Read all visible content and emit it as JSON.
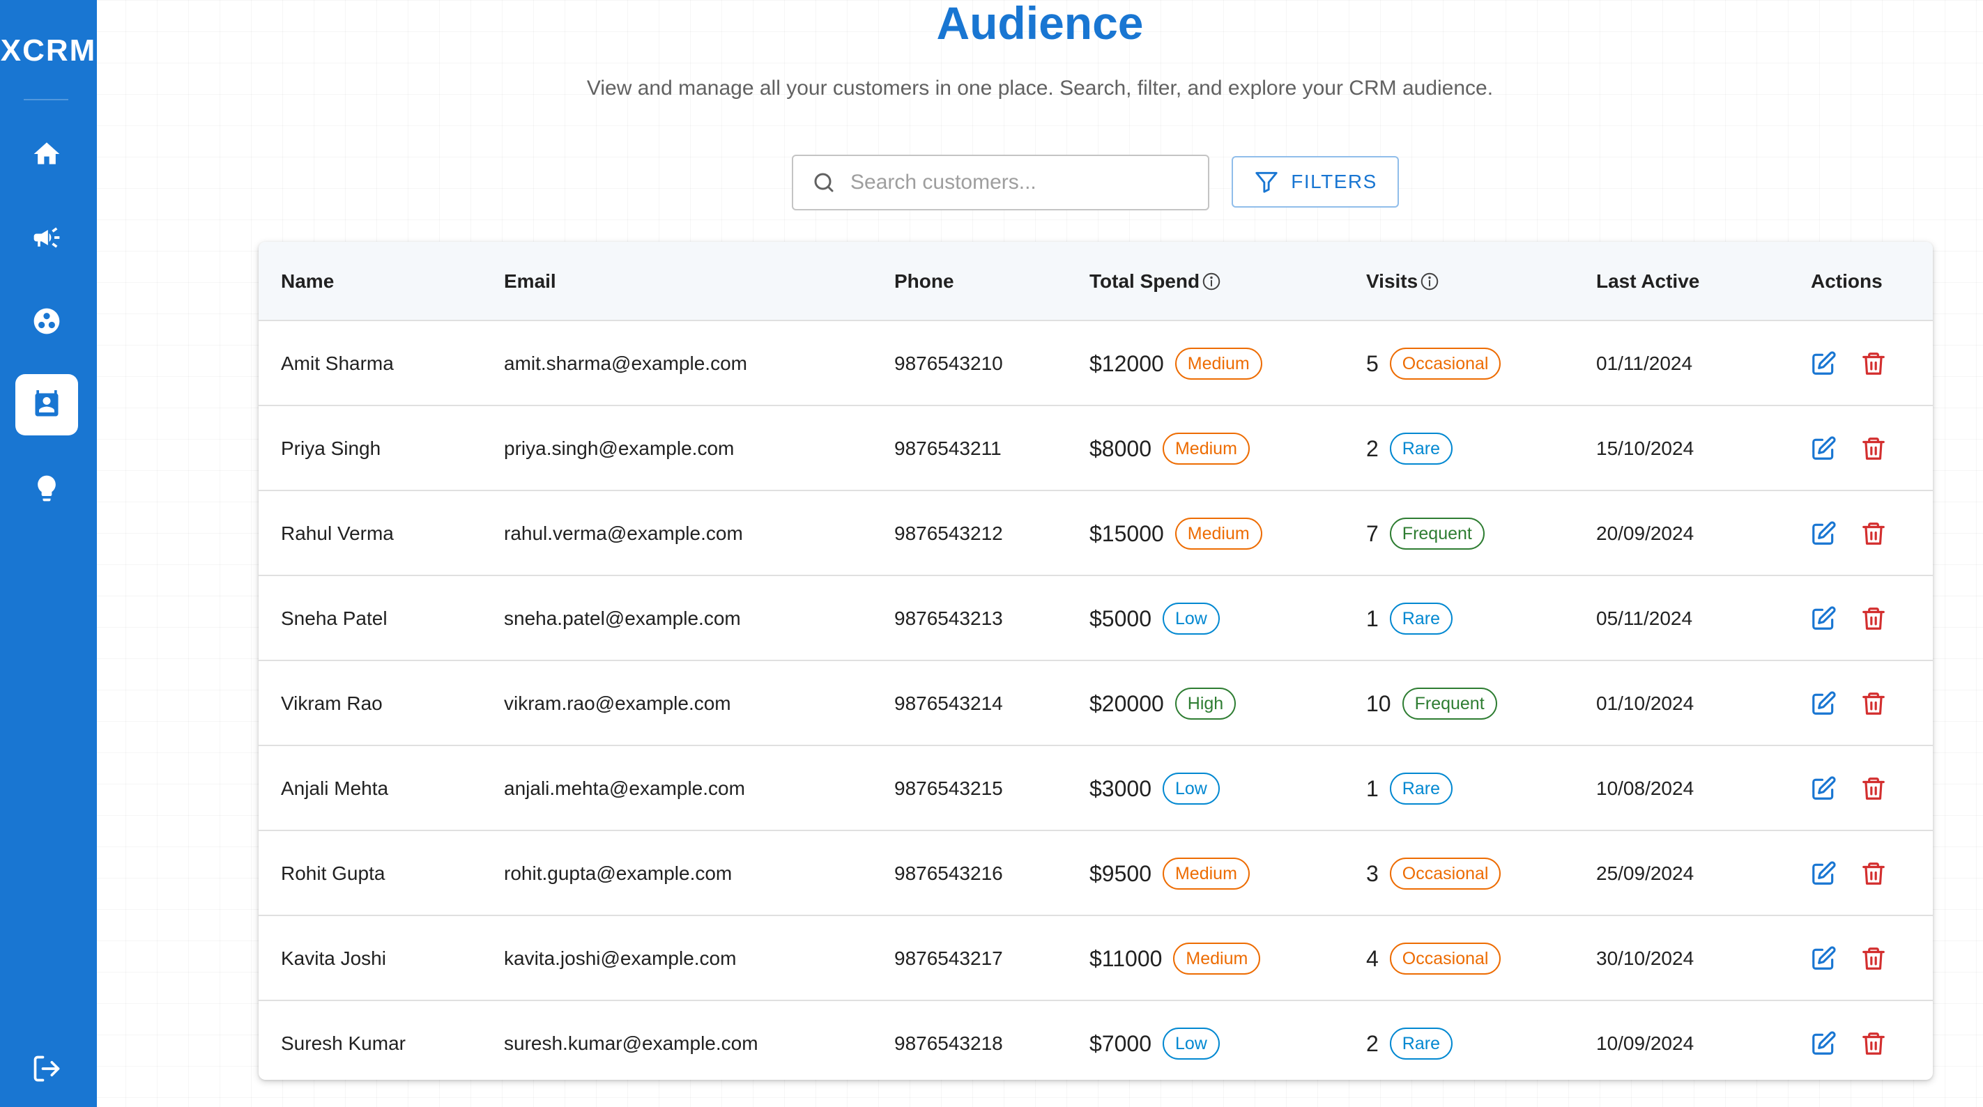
{
  "app": {
    "brand": "XCRM"
  },
  "sidebar": {
    "items": [
      {
        "name": "home",
        "icon": "home-icon",
        "active": false
      },
      {
        "name": "campaigns",
        "icon": "megaphone-icon",
        "active": false
      },
      {
        "name": "segments",
        "icon": "segments-icon",
        "active": false
      },
      {
        "name": "audience",
        "icon": "contact-card-icon",
        "active": true
      },
      {
        "name": "insights",
        "icon": "lightbulb-icon",
        "active": false
      }
    ],
    "logout_icon": "logout-icon"
  },
  "header": {
    "title": "Audience",
    "subtitle": "View and manage all your customers in one place. Search, filter, and explore your CRM audience."
  },
  "search": {
    "placeholder": "Search customers...",
    "value": ""
  },
  "filters": {
    "label": "FILTERS"
  },
  "table": {
    "columns": {
      "name": "Name",
      "email": "Email",
      "phone": "Phone",
      "spend": "Total Spend",
      "visits": "Visits",
      "last_active": "Last Active",
      "actions": "Actions"
    },
    "rows": [
      {
        "name": "Amit Sharma",
        "email": "amit.sharma@example.com",
        "phone": "9876543210",
        "spend": "$12000",
        "spend_tier": "Medium",
        "visits": "5",
        "visit_tier": "Occasional",
        "last_active": "01/11/2024"
      },
      {
        "name": "Priya Singh",
        "email": "priya.singh@example.com",
        "phone": "9876543211",
        "spend": "$8000",
        "spend_tier": "Medium",
        "visits": "2",
        "visit_tier": "Rare",
        "last_active": "15/10/2024"
      },
      {
        "name": "Rahul Verma",
        "email": "rahul.verma@example.com",
        "phone": "9876543212",
        "spend": "$15000",
        "spend_tier": "Medium",
        "visits": "7",
        "visit_tier": "Frequent",
        "last_active": "20/09/2024"
      },
      {
        "name": "Sneha Patel",
        "email": "sneha.patel@example.com",
        "phone": "9876543213",
        "spend": "$5000",
        "spend_tier": "Low",
        "visits": "1",
        "visit_tier": "Rare",
        "last_active": "05/11/2024"
      },
      {
        "name": "Vikram Rao",
        "email": "vikram.rao@example.com",
        "phone": "9876543214",
        "spend": "$20000",
        "spend_tier": "High",
        "visits": "10",
        "visit_tier": "Frequent",
        "last_active": "01/10/2024"
      },
      {
        "name": "Anjali Mehta",
        "email": "anjali.mehta@example.com",
        "phone": "9876543215",
        "spend": "$3000",
        "spend_tier": "Low",
        "visits": "1",
        "visit_tier": "Rare",
        "last_active": "10/08/2024"
      },
      {
        "name": "Rohit Gupta",
        "email": "rohit.gupta@example.com",
        "phone": "9876543216",
        "spend": "$9500",
        "spend_tier": "Medium",
        "visits": "3",
        "visit_tier": "Occasional",
        "last_active": "25/09/2024"
      },
      {
        "name": "Kavita Joshi",
        "email": "kavita.joshi@example.com",
        "phone": "9876543217",
        "spend": "$11000",
        "spend_tier": "Medium",
        "visits": "4",
        "visit_tier": "Occasional",
        "last_active": "30/10/2024"
      },
      {
        "name": "Suresh Kumar",
        "email": "suresh.kumar@example.com",
        "phone": "9876543218",
        "spend": "$7000",
        "spend_tier": "Low",
        "visits": "2",
        "visit_tier": "Rare",
        "last_active": "10/09/2024"
      }
    ]
  },
  "colors": {
    "primary": "#1976d2",
    "tier_medium": "#ed6c02",
    "tier_low": "#0288d1",
    "tier_high": "#2e7d32",
    "tier_occasional": "#ed6c02",
    "tier_rare": "#0288d1",
    "tier_frequent": "#2e7d32",
    "edit": "#1976d2",
    "delete": "#d32f2f"
  }
}
